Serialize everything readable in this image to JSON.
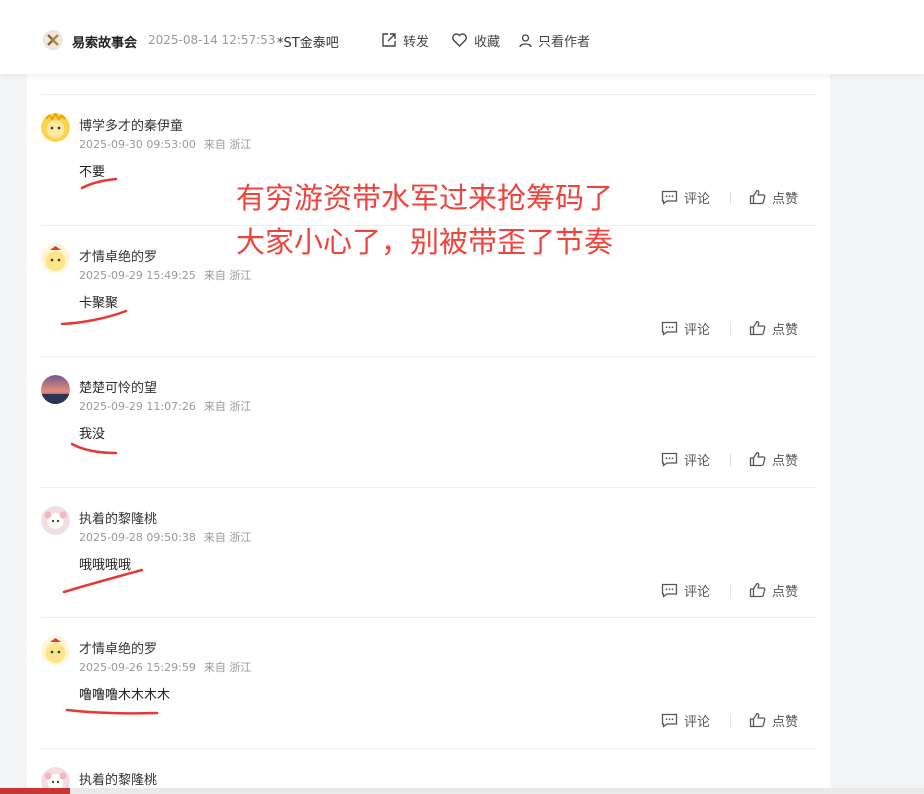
{
  "header": {
    "author": "易索故事会",
    "time": "2025-08-14 12:57:53",
    "bar": "*ST金泰吧",
    "actions": {
      "share": "转发",
      "favorite": "收藏",
      "only_author": "只看作者"
    }
  },
  "overlay": {
    "line1": "有穷游资带水军过来抢筹码了",
    "line2": "大家小心了，别被带歪了节奏"
  },
  "comments": [
    {
      "name": "博学多才的秦伊童",
      "time": "2025-09-30 09:53:00",
      "loc": "来自 浙江",
      "text": "不要",
      "reply": "评论",
      "like": "点赞"
    },
    {
      "name": "才情卓绝的罗",
      "time": "2025-09-29 15:49:25",
      "loc": "来自 浙江",
      "text": "卡聚聚",
      "reply": "评论",
      "like": "点赞"
    },
    {
      "name": "楚楚可怜的望",
      "time": "2025-09-29 11:07:26",
      "loc": "来自 浙江",
      "text": "我没",
      "reply": "评论",
      "like": "点赞"
    },
    {
      "name": "执着的黎隆桃",
      "time": "2025-09-28 09:50:38",
      "loc": "来自 浙江",
      "text": "哦哦哦哦",
      "reply": "评论",
      "like": "点赞"
    },
    {
      "name": "才情卓绝的罗",
      "time": "2025-09-26 15:29:59",
      "loc": "来自 浙江",
      "text": "噜噜噜木木木木",
      "reply": "评论",
      "like": "点赞"
    },
    {
      "name": "执着的黎隆桃"
    }
  ]
}
